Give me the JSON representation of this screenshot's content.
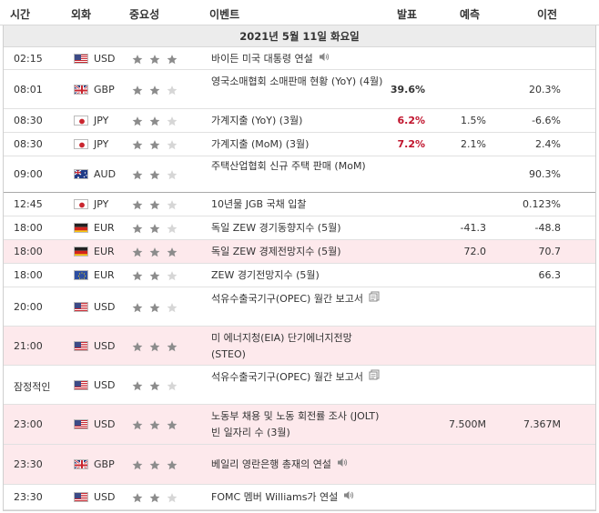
{
  "header": {
    "time": "시간",
    "currency": "외화",
    "importance": "중요성",
    "event": "이벤트",
    "actual": "발표",
    "forecast": "예측",
    "previous": "이전"
  },
  "date_label": "2021년 5월 11일 화요일",
  "colors": {
    "positive": "#c0132c",
    "highlight_row": "#fde9ec",
    "star_on": "#8c8c8c",
    "star_off": "#d6d6d6",
    "date_band": "#ececec"
  },
  "rows": [
    {
      "time": "02:15",
      "flag": "us-flag-icon",
      "currency": "USD",
      "stars": 3,
      "event": "바이든 미국 대통령 연설",
      "icon": "speaker-icon",
      "actual": "",
      "actual_color": "",
      "forecast": "",
      "previous": "",
      "highlight": false
    },
    {
      "time": "08:01",
      "flag": "gb-flag-icon",
      "currency": "GBP",
      "stars": 2,
      "event": "영국소매협회 소매판매 현황 (YoY) (4월)",
      "icon": "",
      "actual": "39.6%",
      "actual_color": "black",
      "forecast": "",
      "previous": "20.3%",
      "highlight": false
    },
    {
      "time": "08:30",
      "flag": "jp-flag-icon",
      "currency": "JPY",
      "stars": 2,
      "event": "가계지출 (YoY) (3월)",
      "icon": "",
      "actual": "6.2%",
      "actual_color": "red",
      "forecast": "1.5%",
      "previous": "-6.6%",
      "highlight": false
    },
    {
      "time": "08:30",
      "flag": "jp-flag-icon",
      "currency": "JPY",
      "stars": 2,
      "event": "가계지출 (MoM) (3월)",
      "icon": "",
      "actual": "7.2%",
      "actual_color": "red",
      "forecast": "2.1%",
      "previous": "2.4%",
      "highlight": false
    },
    {
      "time": "09:00",
      "flag": "au-flag-icon",
      "currency": "AUD",
      "stars": 2,
      "event": "주택산업협회 신규 주택 판매 (MoM)",
      "icon": "",
      "actual": "",
      "actual_color": "",
      "forecast": "",
      "previous": "90.3%",
      "highlight": false
    },
    {
      "time": "12:45",
      "flag": "jp-flag-icon",
      "currency": "JPY",
      "stars": 2,
      "event": "10년물 JGB 국채 입찰",
      "icon": "",
      "actual": "",
      "actual_color": "",
      "forecast": "",
      "previous": "0.123%",
      "highlight": false
    },
    {
      "time": "18:00",
      "flag": "de-flag-icon",
      "currency": "EUR",
      "stars": 2,
      "event": "독일 ZEW 경기동향지수 (5월)",
      "icon": "",
      "actual": "",
      "actual_color": "",
      "forecast": "-41.3",
      "previous": "-48.8",
      "highlight": false
    },
    {
      "time": "18:00",
      "flag": "de-flag-icon",
      "currency": "EUR",
      "stars": 3,
      "event": "독일 ZEW 경제전망지수 (5월)",
      "icon": "",
      "actual": "",
      "actual_color": "",
      "forecast": "72.0",
      "previous": "70.7",
      "highlight": true
    },
    {
      "time": "18:00",
      "flag": "eu-flag-icon",
      "currency": "EUR",
      "stars": 2,
      "event": "ZEW 경기전망지수 (5월)",
      "icon": "",
      "actual": "",
      "actual_color": "",
      "forecast": "",
      "previous": "66.3",
      "highlight": false
    },
    {
      "time": "20:00",
      "flag": "us-flag-icon",
      "currency": "USD",
      "stars": 2,
      "event": "석유수출국기구(OPEC) 월간 보고서",
      "icon": "document-icon",
      "actual": "",
      "actual_color": "",
      "forecast": "",
      "previous": "",
      "highlight": false
    },
    {
      "time": "21:00",
      "flag": "us-flag-icon",
      "currency": "USD",
      "stars": 3,
      "event": "미 에너지청(EIA) 단기에너지전망(STEO)",
      "icon": "",
      "actual": "",
      "actual_color": "",
      "forecast": "",
      "previous": "",
      "highlight": true
    },
    {
      "time": "잠정적인",
      "flag": "us-flag-icon",
      "currency": "USD",
      "stars": 2,
      "event": "석유수출국기구(OPEC) 월간 보고서",
      "icon": "document-icon",
      "actual": "",
      "actual_color": "",
      "forecast": "",
      "previous": "",
      "highlight": false
    },
    {
      "time": "23:00",
      "flag": "us-flag-icon",
      "currency": "USD",
      "stars": 3,
      "event": "노동부 채용 및 노동 회전률 조사 (JOLT) 빈 일자리 수 (3월)",
      "icon": "",
      "actual": "",
      "actual_color": "",
      "forecast": "7.500M",
      "previous": "7.367M",
      "highlight": true
    },
    {
      "time": "23:30",
      "flag": "gb-flag-icon",
      "currency": "GBP",
      "stars": 3,
      "event": "베일리 영란은행 총재의 연설",
      "icon": "speaker-icon",
      "actual": "",
      "actual_color": "",
      "forecast": "",
      "previous": "",
      "highlight": true
    },
    {
      "time": "23:30",
      "flag": "us-flag-icon",
      "currency": "USD",
      "stars": 2,
      "event": "FOMC 멤버 Williams가 연설",
      "icon": "speaker-icon",
      "actual": "",
      "actual_color": "",
      "forecast": "",
      "previous": "",
      "highlight": false
    }
  ]
}
